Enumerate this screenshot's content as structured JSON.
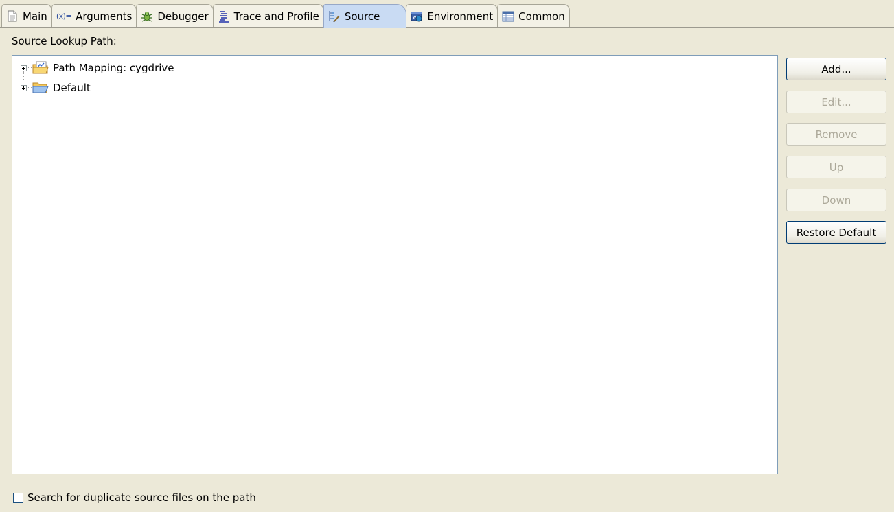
{
  "tabs": [
    {
      "label": "Main",
      "icon": "document-icon",
      "active": false
    },
    {
      "label": "Arguments",
      "icon": "arguments-icon",
      "active": false
    },
    {
      "label": "Debugger",
      "icon": "bug-icon",
      "active": false
    },
    {
      "label": "Trace and Profile",
      "icon": "trace-icon",
      "active": false
    },
    {
      "label": "Source",
      "icon": "source-icon",
      "active": true
    },
    {
      "label": "Environment",
      "icon": "environment-icon",
      "active": false
    },
    {
      "label": "Common",
      "icon": "common-icon",
      "active": false
    }
  ],
  "arguments_icon_glyph": "(x)=",
  "source_lookup": {
    "label": "Source Lookup Path:",
    "items": [
      {
        "label": "Path Mapping: cygdrive",
        "icon": "path-mapping-folder-icon",
        "expanded": false
      },
      {
        "label": "Default",
        "icon": "folder-icon",
        "expanded": false
      }
    ]
  },
  "buttons": {
    "add": {
      "label": "Add...",
      "enabled": true
    },
    "edit": {
      "label": "Edit...",
      "enabled": false
    },
    "remove": {
      "label": "Remove",
      "enabled": false
    },
    "up": {
      "label": "Up",
      "enabled": false
    },
    "down": {
      "label": "Down",
      "enabled": false
    },
    "restore_default": {
      "label": "Restore Default",
      "enabled": true
    }
  },
  "search_duplicates": {
    "label": "Search for duplicate source files on the path",
    "checked": false
  },
  "colors": {
    "background": "#ece9d8",
    "active_tab": "#c9dbf3",
    "button_border": "#003c74",
    "disabled_text": "#aca899",
    "tree_border": "#7f9db9"
  }
}
